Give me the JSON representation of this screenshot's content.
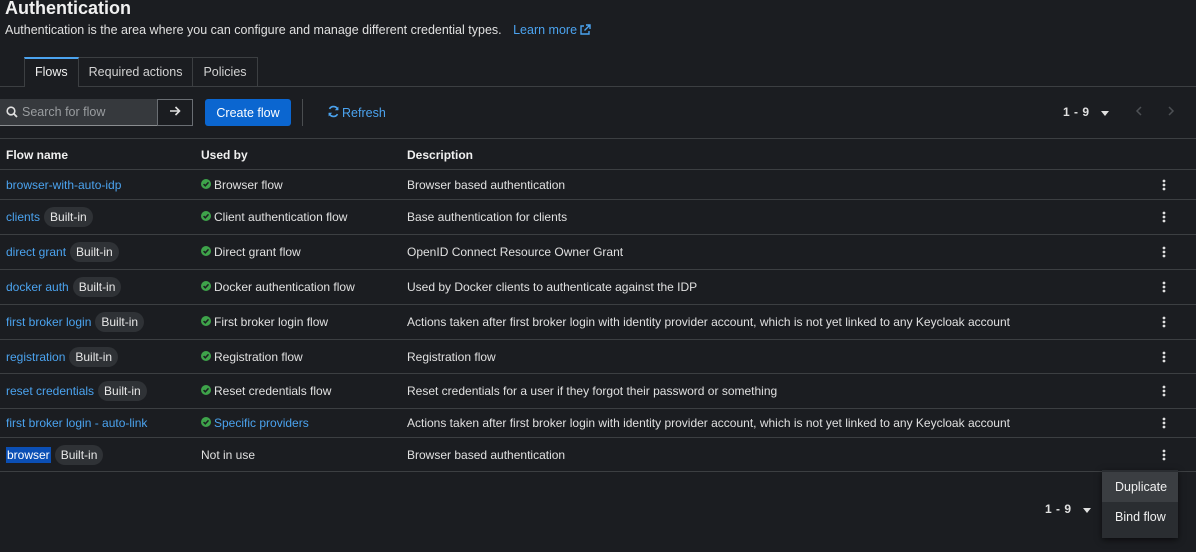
{
  "header": {
    "title": "Authentication",
    "subtitle": "Authentication is the area where you can configure and manage different credential types.",
    "learn_more": "Learn more"
  },
  "tabs": [
    {
      "label": "Flows",
      "active": true
    },
    {
      "label": "Required actions",
      "active": false
    },
    {
      "label": "Policies",
      "active": false
    }
  ],
  "toolbar": {
    "search_placeholder": "Search for flow",
    "create_label": "Create flow",
    "refresh_label": "Refresh"
  },
  "pagination": {
    "top": "1 - 9",
    "bottom": "1 - 9"
  },
  "table": {
    "columns": [
      "Flow name",
      "Used by",
      "Description"
    ],
    "rows": [
      {
        "name": "browser-with-auto-idp",
        "builtin": false,
        "used_by": "Browser flow",
        "used_type": "check",
        "description": "Browser based authentication"
      },
      {
        "name": "clients",
        "builtin": true,
        "used_by": "Client authentication flow",
        "used_type": "check",
        "description": "Base authentication for clients"
      },
      {
        "name": "direct grant",
        "builtin": true,
        "used_by": "Direct grant flow",
        "used_type": "check",
        "description": "OpenID Connect Resource Owner Grant"
      },
      {
        "name": "docker auth",
        "builtin": true,
        "used_by": "Docker authentication flow",
        "used_type": "check",
        "description": "Used by Docker clients to authenticate against the IDP"
      },
      {
        "name": "first broker login",
        "builtin": true,
        "used_by": "First broker login flow",
        "used_type": "check",
        "description": "Actions taken after first broker login with identity provider account, which is not yet linked to any Keycloak account"
      },
      {
        "name": "registration",
        "builtin": true,
        "used_by": "Registration flow",
        "used_type": "check",
        "description": "Registration flow"
      },
      {
        "name": "reset credentials",
        "builtin": true,
        "used_by": "Reset credentials flow",
        "used_type": "check",
        "description": "Reset credentials for a user if they forgot their password or something"
      },
      {
        "name": "first broker login - auto-link",
        "builtin": false,
        "used_by": "Specific providers",
        "used_type": "link",
        "description": "Actions taken after first broker login with identity provider account, which is not yet linked to any Keycloak account"
      },
      {
        "name": "browser",
        "builtin": true,
        "used_by": "Not in use",
        "used_type": "none",
        "description": "Browser based authentication",
        "selected": true
      }
    ],
    "builtin_label": "Built-in"
  },
  "menu": {
    "items": [
      "Duplicate",
      "Bind flow"
    ]
  },
  "colors": {
    "accent": "#4ba3ef",
    "primary": "#0b66d0",
    "success": "#3ea34a",
    "background": "#1b1d21"
  }
}
